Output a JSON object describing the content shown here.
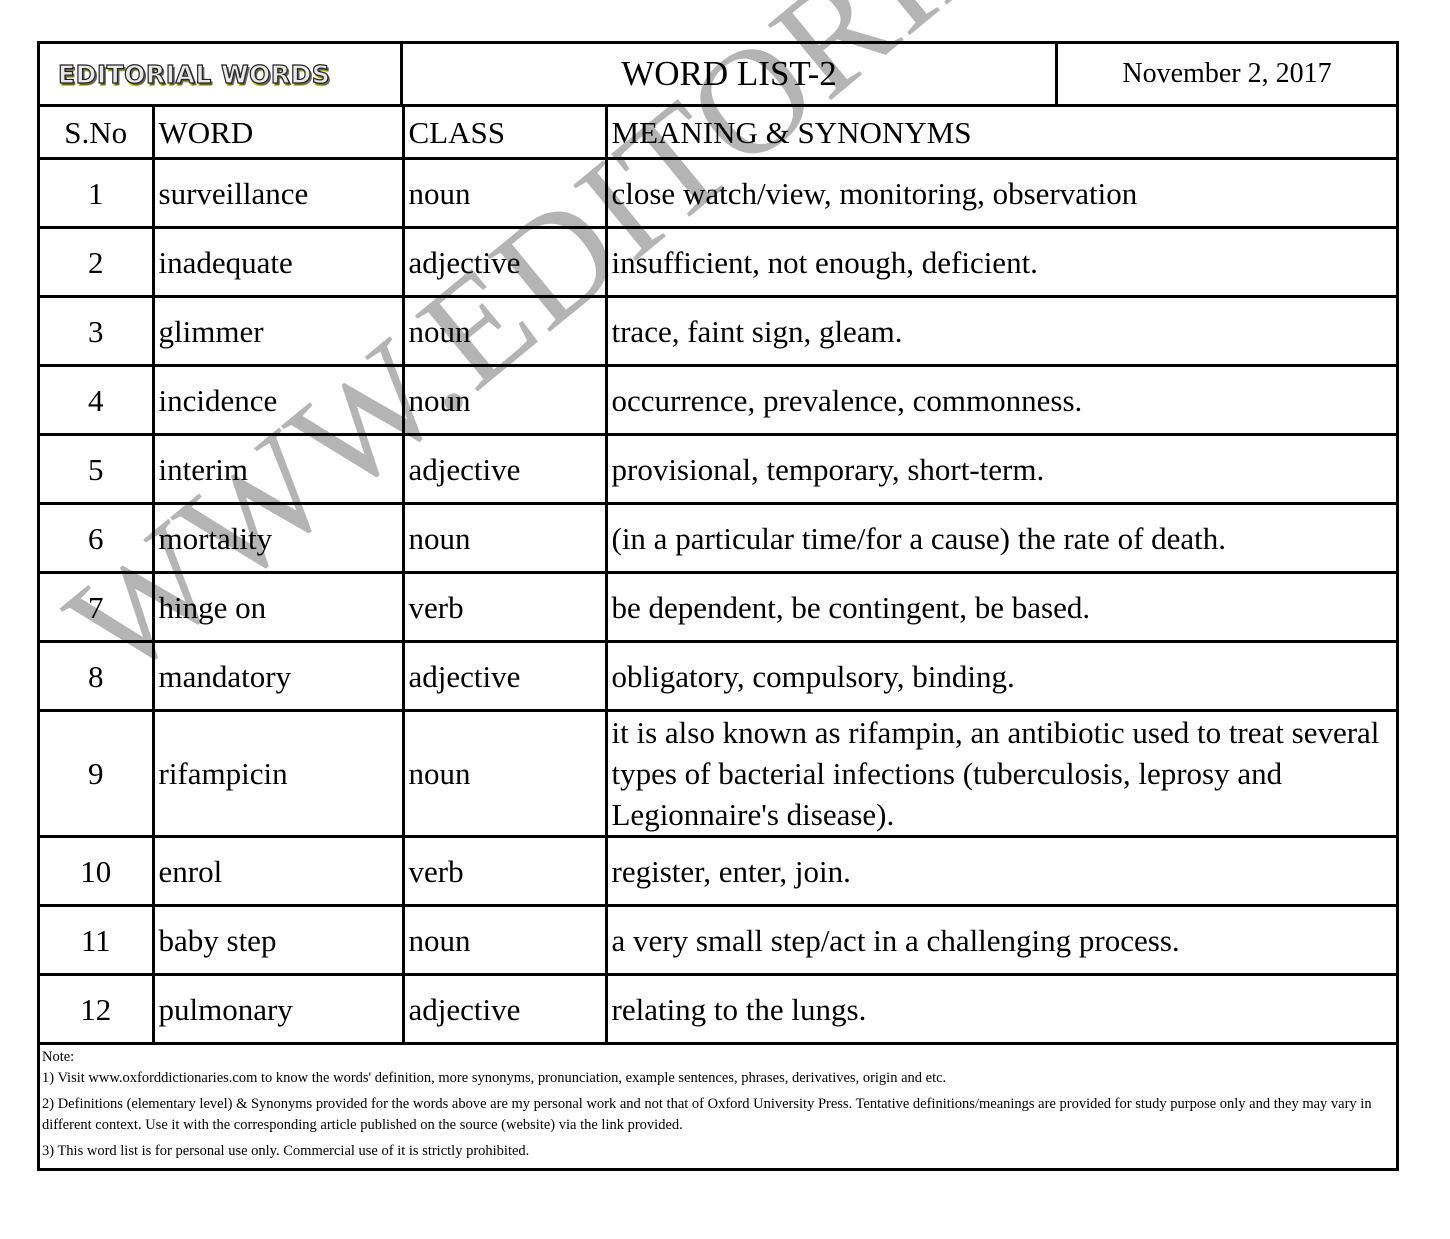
{
  "header": {
    "logo_text": "EDITORIAL WORDS",
    "list_title": "WORD LIST-2",
    "date": "November 2, 2017"
  },
  "table": {
    "columns": [
      "S.No",
      "WORD",
      "CLASS",
      "MEANING & SYNONYMS"
    ],
    "rows": [
      {
        "sno": "1",
        "word": "surveillance",
        "class": "noun",
        "meaning": "close watch/view, monitoring, observation"
      },
      {
        "sno": "2",
        "word": "inadequate",
        "class": "adjective",
        "meaning": "insufficient, not enough, deficient."
      },
      {
        "sno": "3",
        "word": "glimmer",
        "class": "noun",
        "meaning": "trace, faint sign, gleam."
      },
      {
        "sno": "4",
        "word": "incidence",
        "class": "noun",
        "meaning": "occurrence, prevalence, commonness."
      },
      {
        "sno": "5",
        "word": "interim",
        "class": "adjective",
        "meaning": "provisional, temporary, short-term."
      },
      {
        "sno": "6",
        "word": "mortality",
        "class": "noun",
        "meaning": "(in a particular time/for a cause) the rate of death."
      },
      {
        "sno": "7",
        "word": "hinge on",
        "class": "verb",
        "meaning": "be dependent, be contingent, be based."
      },
      {
        "sno": "8",
        "word": "mandatory",
        "class": "adjective",
        "meaning": "obligatory, compulsory, binding."
      },
      {
        "sno": "9",
        "word": "rifampicin",
        "class": "noun",
        "meaning": "it is also known as rifampin, an antibiotic used to treat several types of bacterial infections (tuberculosis, leprosy and Legionnaire's disease)."
      },
      {
        "sno": "10",
        "word": "enrol",
        "class": "verb",
        "meaning": "register, enter, join."
      },
      {
        "sno": "11",
        "word": "baby step",
        "class": "noun",
        "meaning": "a very small step/act in a challenging process."
      },
      {
        "sno": "12",
        "word": "pulmonary",
        "class": "adjective",
        "meaning": "relating to the lungs."
      }
    ]
  },
  "notes": {
    "heading": "Note:",
    "items": [
      "1) Visit www.oxforddictionaries.com to know the words' definition, more synonyms, pronunciation, example sentences, phrases, derivatives, origin and etc.",
      "2) Definitions (elementary level) & Synonyms provided for the words above are my personal work and not that of Oxford University Press. Tentative definitions/meanings are provided for study purpose only and they may vary in different context. Use it with the corresponding article published on the source (website) via the link provided.",
      "3) This word list is for personal use only. Commercial use of it is strictly prohibited."
    ]
  },
  "watermark": {
    "text": "WWW.EDITORIALWORDS.COM",
    "color": "#b0b0b0"
  }
}
